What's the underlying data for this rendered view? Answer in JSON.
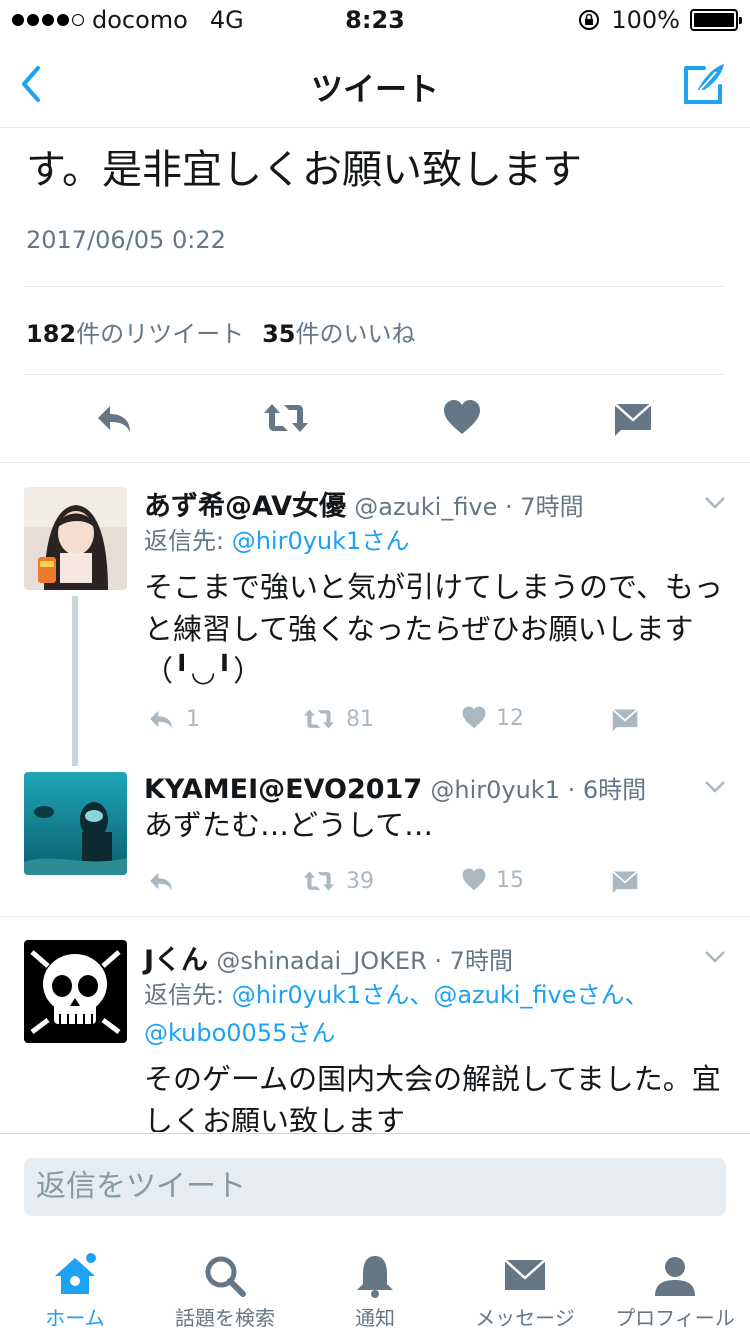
{
  "status_bar": {
    "carrier": "docomo",
    "network": "4G",
    "time": "8:23",
    "battery": "100%",
    "battery_level": 1.0
  },
  "nav": {
    "title": "ツイート"
  },
  "main_tweet": {
    "text": "す。是非宜しくお願い致します",
    "timestamp": "2017/06/05 0:22",
    "retweet_count": "182",
    "retweet_label": "件のリツイート",
    "like_count": "35",
    "like_label": "件のいいね"
  },
  "replies": [
    {
      "name": "あず希@AV女優",
      "handle": "@azuki_five",
      "time": "7時間",
      "replying_label": "返信先: ",
      "replying_to": "@hir0yuk1さん",
      "text": "そこまで強いと気が引けてしまうので、もっと練習して強くなったらぜひお願いします（╹◡╹）",
      "reply_count": "1",
      "retweet_count": "81",
      "like_count": "12"
    },
    {
      "name": "KYAMEI@EVO2017",
      "handle": "@hir0yuk1",
      "time": "6時間",
      "text": "あずたむ…どうして…",
      "reply_count": "",
      "retweet_count": "39",
      "like_count": "15"
    },
    {
      "name": "Jくん",
      "handle": "@shinadai_JOKER",
      "time": "7時間",
      "replying_label": "返信先: ",
      "replying_to_line1": "@hir0yuk1さん、@azuki_fiveさん、",
      "replying_to_line2": "@kubo0055さん",
      "text": "そのゲームの国内大会の解説してました。宜しくお願い致します"
    }
  ],
  "reply_box": {
    "placeholder": "返信をツイート"
  },
  "tab_bar": [
    {
      "label": "ホーム",
      "icon": "home-icon",
      "active": true
    },
    {
      "label": "話題を検索",
      "icon": "search-icon"
    },
    {
      "label": "通知",
      "icon": "bell-icon"
    },
    {
      "label": "メッセージ",
      "icon": "envelope-icon"
    },
    {
      "label": "プロフィール",
      "icon": "person-icon"
    }
  ],
  "colors": {
    "accent": "#1da1f2",
    "muted": "#657786",
    "icon_gray": "#aab8c2",
    "action_gray": "#657786"
  }
}
